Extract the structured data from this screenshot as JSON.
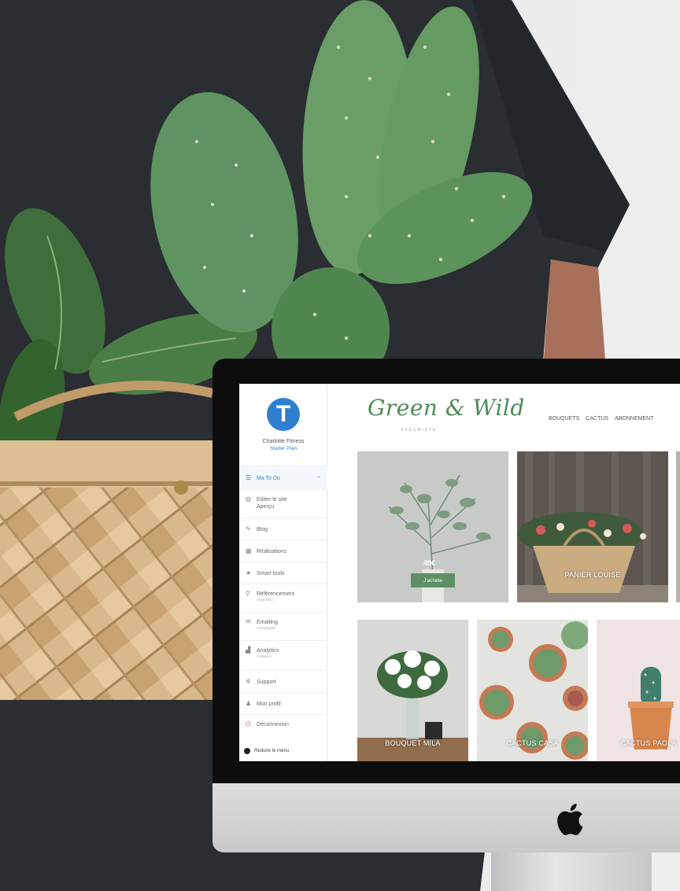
{
  "admin": {
    "account": {
      "logo_letter": "T",
      "name": "Charlotte Fitness",
      "plan": "Starter Plan"
    },
    "menu": [
      {
        "label": "Ma To Do",
        "sub": "",
        "icon": "checklist-icon",
        "active": true
      },
      {
        "label": "Editer le site",
        "sub": "Aperçu",
        "icon": "palette-icon"
      },
      {
        "label": "Blog",
        "sub": "",
        "icon": "pen-icon"
      },
      {
        "label": "Réalisations",
        "sub": "",
        "icon": "gallery-icon"
      },
      {
        "label": "Smart tools",
        "sub": "",
        "icon": "star-icon"
      },
      {
        "label": "Référencement",
        "sub": "Ajout SEO",
        "icon": "search-icon"
      },
      {
        "label": "Emailing",
        "sub": "Campagnes",
        "icon": "mail-icon"
      },
      {
        "label": "Analytics",
        "sub": "Analytics",
        "icon": "chart-icon"
      },
      {
        "label": "Support",
        "sub": "",
        "icon": "support-icon"
      },
      {
        "label": "Mon profil",
        "sub": "",
        "icon": "user-icon"
      },
      {
        "label": "Déconnexion",
        "sub": "",
        "icon": "power-icon"
      }
    ],
    "collapse_label": "Réduire le menu"
  },
  "site": {
    "logo": "Green & Wild",
    "tagline": "FLEURISTE",
    "nav": [
      "BOUQUETS",
      "CACTUS",
      "ABONNEMENT"
    ],
    "featured": {
      "price": "49€",
      "button": "J'achète"
    },
    "products": [
      "PANIER LOUISE",
      "BOUQUET MILA",
      "CACTUS CASA",
      "CACTUS PAOLA"
    ]
  },
  "colors": {
    "brand_green": "#4c8c57",
    "button_green": "#5e8f64",
    "accent_blue": "#2f7fd0",
    "bezel": "#0d0d0d"
  }
}
